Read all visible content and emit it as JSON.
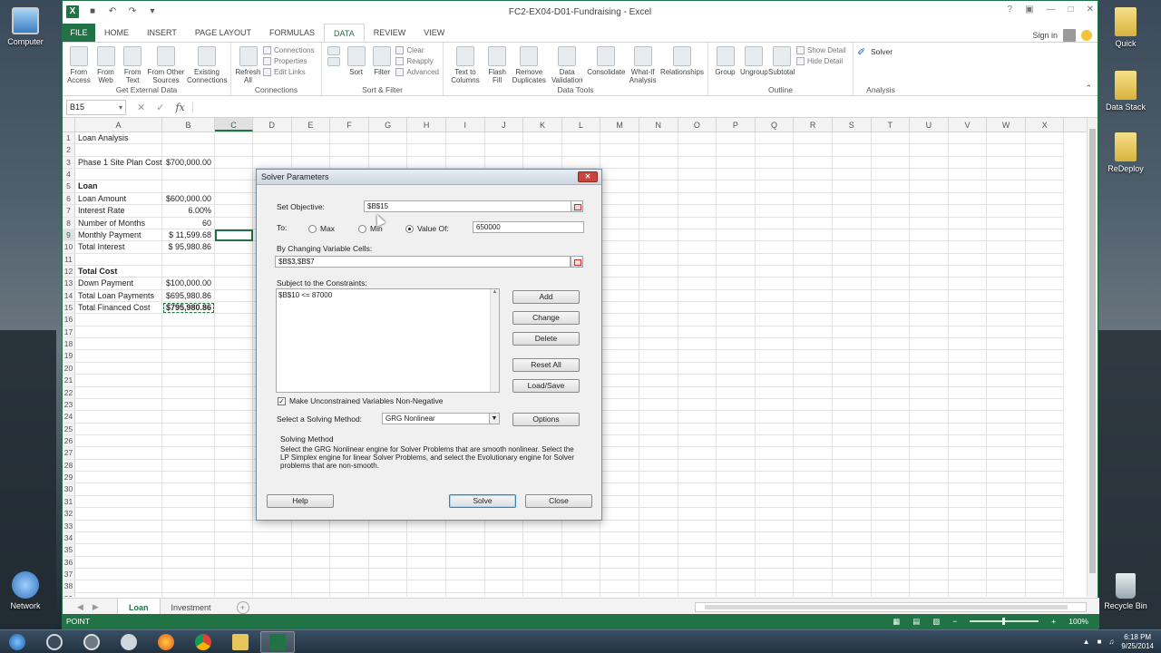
{
  "desktop": {
    "icons_left": [
      "Computer",
      "Network"
    ],
    "icons_right": [
      "Quick",
      "Data Stack",
      "ReDeploy",
      "Recycle Bin"
    ]
  },
  "window": {
    "title": "FC2-EX04-D01-Fundraising - Excel",
    "signin": "Sign in"
  },
  "ribbon_tabs": [
    "FILE",
    "HOME",
    "INSERT",
    "PAGE LAYOUT",
    "FORMULAS",
    "DATA",
    "REVIEW",
    "VIEW"
  ],
  "active_tab": "DATA",
  "ribbon": {
    "get_external": {
      "name": "Get External Data",
      "buttons": [
        "From Access",
        "From Web",
        "From Text",
        "From Other Sources",
        "Existing Connections"
      ]
    },
    "connections": {
      "name": "Connections",
      "refresh": "Refresh All",
      "small": [
        "Connections",
        "Properties",
        "Edit Links"
      ]
    },
    "sort_filter": {
      "name": "Sort & Filter",
      "sort": "Sort",
      "filter": "Filter",
      "small": [
        "Clear",
        "Reapply",
        "Advanced"
      ]
    },
    "data_tools": {
      "name": "Data Tools",
      "buttons": [
        "Text to Columns",
        "Flash Fill",
        "Remove Duplicates",
        "Data Validation",
        "Consolidate",
        "What-If Analysis",
        "Relationships"
      ]
    },
    "outline": {
      "name": "Outline",
      "buttons": [
        "Group",
        "Ungroup",
        "Subtotal"
      ],
      "small": [
        "Show Detail",
        "Hide Detail"
      ]
    },
    "analysis": {
      "name": "Analysis",
      "solver": "Solver"
    }
  },
  "formula_bar": {
    "name_box": "B15",
    "formula": ""
  },
  "columns": [
    "A",
    "B",
    "C",
    "D",
    "E",
    "F",
    "G",
    "H",
    "I",
    "J",
    "K",
    "L",
    "M",
    "N",
    "O",
    "P",
    "Q",
    "R",
    "S",
    "T",
    "U",
    "V",
    "W",
    "X"
  ],
  "selected_column": "C",
  "rows": [
    {
      "n": "1",
      "a": "Loan Analysis",
      "b": "",
      "a_bold": false
    },
    {
      "n": "2",
      "a": "",
      "b": ""
    },
    {
      "n": "3",
      "a": "Phase 1 Site Plan Cost",
      "b": "$700,000.00"
    },
    {
      "n": "4",
      "a": "",
      "b": ""
    },
    {
      "n": "5",
      "a": "Loan",
      "b": "",
      "a_bold": true
    },
    {
      "n": "6",
      "a": "Loan Amount",
      "b": "$600,000.00"
    },
    {
      "n": "7",
      "a": "Interest Rate",
      "b": "6.00%"
    },
    {
      "n": "8",
      "a": "Number of Months",
      "b": "60"
    },
    {
      "n": "9",
      "a": "Monthly Payment",
      "b": "$  11,599.68"
    },
    {
      "n": "10",
      "a": "Total Interest",
      "b": "$  95,980.86"
    },
    {
      "n": "11",
      "a": "",
      "b": ""
    },
    {
      "n": "12",
      "a": "Total Cost",
      "b": "",
      "a_bold": true
    },
    {
      "n": "13",
      "a": "Down Payment",
      "b": "$100,000.00"
    },
    {
      "n": "14",
      "a": "Total Loan Payments",
      "b": "$695,980.86"
    },
    {
      "n": "15",
      "a": "Total  Financed Cost",
      "b": "$795,980.86"
    },
    {
      "n": "16"
    },
    {
      "n": "17"
    },
    {
      "n": "18"
    },
    {
      "n": "19"
    },
    {
      "n": "20"
    },
    {
      "n": "21"
    },
    {
      "n": "22"
    },
    {
      "n": "23"
    },
    {
      "n": "24"
    },
    {
      "n": "25"
    },
    {
      "n": "26"
    },
    {
      "n": "27"
    },
    {
      "n": "28"
    },
    {
      "n": "29"
    },
    {
      "n": "30"
    },
    {
      "n": "31"
    },
    {
      "n": "32"
    },
    {
      "n": "33"
    },
    {
      "n": "34"
    },
    {
      "n": "35"
    },
    {
      "n": "36"
    },
    {
      "n": "37"
    },
    {
      "n": "38"
    },
    {
      "n": "39"
    }
  ],
  "sheets": [
    "Loan",
    "Investment"
  ],
  "active_sheet": "Loan",
  "status": {
    "mode": "POINT",
    "zoom": "100%"
  },
  "solver": {
    "title": "Solver Parameters",
    "set_objective_label": "Set Objective:",
    "objective": "$B$15",
    "to_label": "To:",
    "max": "Max",
    "min": "Min",
    "value_of": "Value Of:",
    "value": "650000",
    "selected": "value_of",
    "changing_label": "By Changing Variable Cells:",
    "changing": "$B$3,$B$7",
    "constraints_label": "Subject to the Constraints:",
    "constraints": [
      "$B$10 <= 87000"
    ],
    "buttons": [
      "Add",
      "Change",
      "Delete",
      "Reset All",
      "Load/Save"
    ],
    "nonneg_label": "Make Unconstrained Variables Non-Negative",
    "nonneg_checked": true,
    "method_label": "Select a Solving Method:",
    "method": "GRG Nonlinear",
    "options": "Options",
    "solving_method_heading": "Solving Method",
    "solving_method_desc": "Select the GRG Nonlinear engine for Solver Problems that are smooth nonlinear. Select the LP Simplex engine for linear Solver Problems, and select the Evolutionary engine for Solver problems that are non-smooth.",
    "help": "Help",
    "solve": "Solve",
    "close": "Close"
  },
  "taskbar": {
    "time": "6:18 PM",
    "date": "9/25/2014"
  }
}
